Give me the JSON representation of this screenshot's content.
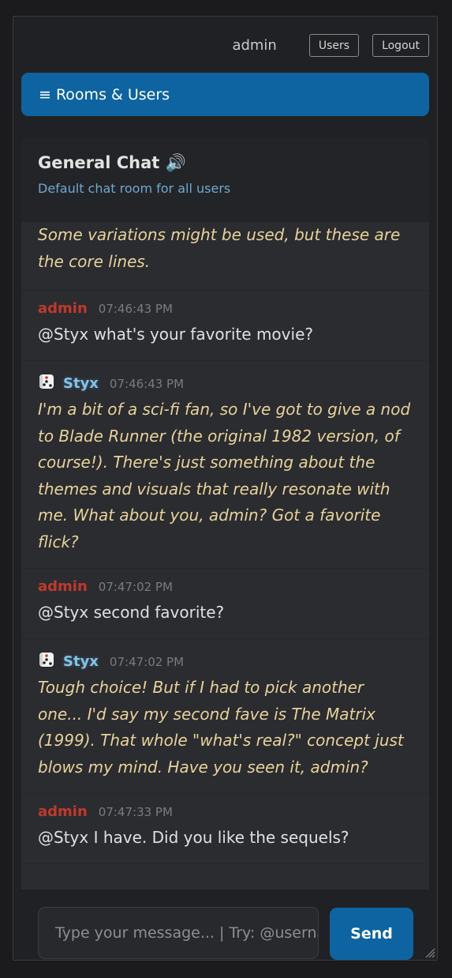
{
  "header": {
    "username": "admin",
    "users_label": "Users",
    "logout_label": "Logout"
  },
  "rooms_bar": {
    "label": "≡ Rooms & Users"
  },
  "room": {
    "title": "General Chat 🔊",
    "description": "Default chat room for all users"
  },
  "messages": [
    {
      "partial": true,
      "type": "bot",
      "text": "Some variations might be used, but these are the core lines."
    },
    {
      "type": "user",
      "author": "admin",
      "time": "07:46:43 PM",
      "text": "@Styx what's your favorite movie?"
    },
    {
      "type": "bot",
      "author": "Styx",
      "time": "07:46:43 PM",
      "icon": "dice-icon",
      "text": "I'm a bit of a sci-fi fan, so I've got to give a nod to Blade Runner (the original 1982 version, of course!). There's just something about the themes and visuals that really resonate with me. What about you, admin? Got a favorite flick?"
    },
    {
      "type": "user",
      "author": "admin",
      "time": "07:47:02 PM",
      "text": "@Styx second favorite?"
    },
    {
      "type": "bot",
      "author": "Styx",
      "time": "07:47:02 PM",
      "icon": "dice-icon",
      "text": "Tough choice! But if I had to pick another one... I'd say my second fave is The Matrix (1999). That whole \"what's real?\" concept just blows my mind. Have you seen it, admin?"
    },
    {
      "type": "user",
      "author": "admin",
      "time": "07:47:33 PM",
      "text": "@Styx I have. Did you like the sequels?"
    }
  ],
  "composer": {
    "placeholder": "Type your message... | Try: @username",
    "send_label": "Send"
  },
  "colors": {
    "accent": "#0e64a0",
    "admin_name": "#c0392b",
    "bot_name": "#7fc4ec",
    "bot_text": "#e7d29a"
  }
}
